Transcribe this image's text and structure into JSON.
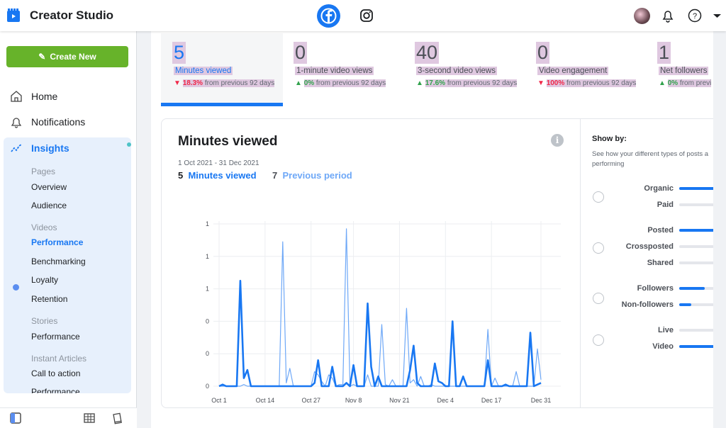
{
  "header": {
    "title": "Creator Studio",
    "icons": [
      "creator-studio-logo",
      "facebook-icon",
      "instagram-icon",
      "avatar",
      "bell-icon",
      "help-icon",
      "dropdown-caret-icon"
    ]
  },
  "sidebar": {
    "create_label": "Create New",
    "nav": [
      {
        "label": "Home",
        "icon": "home-icon"
      },
      {
        "label": "Notifications",
        "icon": "bell-icon"
      },
      {
        "label": "Insights",
        "icon": "insights-icon"
      }
    ],
    "groups": [
      {
        "label": "Pages",
        "items": [
          "Overview",
          "Audience"
        ]
      },
      {
        "label": "Videos",
        "items": [
          "Performance",
          "Benchmarking",
          "Loyalty",
          "Retention"
        ]
      },
      {
        "label": "Stories",
        "items": [
          "Performance"
        ]
      },
      {
        "label": "Instant Articles",
        "items": [
          "Call to action",
          "Performance"
        ]
      }
    ],
    "active_item": "Performance"
  },
  "metrics": [
    {
      "value": "5",
      "label": "Minutes viewed",
      "direction": "down",
      "change": "18.3%",
      "suffix": "from previous 92 days"
    },
    {
      "value": "0",
      "label": "1-minute video views",
      "direction": "up",
      "change": "0%",
      "suffix": "from previous 92 days"
    },
    {
      "value": "40",
      "label": "3-second video views",
      "direction": "up",
      "change": "17.6%",
      "suffix": "from previous 92 days"
    },
    {
      "value": "0",
      "label": "Video engagement",
      "direction": "down",
      "change": "100%",
      "suffix": "from previous 92 days"
    },
    {
      "value": "1",
      "label": "Net followers",
      "direction": "up",
      "change": "0%",
      "suffix": "from previ"
    }
  ],
  "chart_card": {
    "title": "Minutes viewed",
    "info": "i",
    "range": "1 Oct 2021 - 31 Dec 2021",
    "current_value": "5",
    "current_label": "Minutes viewed",
    "previous_value": "7",
    "previous_label": "Previous period"
  },
  "chart_data": {
    "type": "line",
    "x_start": "2021-10-01",
    "x_end": "2021-12-31",
    "x_ticks": [
      "Oct 1",
      "Oct 14",
      "Oct 27",
      "Nov 8",
      "Nov 21",
      "Dec 4",
      "Dec 17",
      "Dec 31"
    ],
    "y_ticks": [
      "0",
      "0",
      "0",
      "1",
      "1",
      "1"
    ],
    "ylim": [
      0,
      1
    ],
    "grid": true,
    "series": [
      {
        "name": "Minutes viewed",
        "color": "#1877f2",
        "values": [
          0,
          0.01,
          0,
          0,
          0,
          0,
          0.65,
          0.05,
          0.1,
          0,
          0,
          0,
          0,
          0,
          0,
          0,
          0,
          0,
          0,
          0,
          0,
          0,
          0,
          0,
          0,
          0,
          0,
          0.02,
          0.16,
          0,
          0,
          0,
          0.12,
          0,
          0,
          0,
          0.02,
          0,
          0.13,
          0,
          0,
          0,
          0.51,
          0.12,
          0,
          0.06,
          0,
          0,
          0,
          0,
          0,
          0,
          0,
          0,
          0.1,
          0.25,
          0.02,
          0,
          0,
          0,
          0,
          0.14,
          0.03,
          0.02,
          0,
          0,
          0.4,
          0,
          0,
          0.06,
          0,
          0,
          0,
          0,
          0,
          0,
          0.16,
          0,
          0,
          0,
          0,
          0.01,
          0,
          0,
          0,
          0,
          0,
          0,
          0.33,
          0,
          0.01,
          0.02
        ]
      },
      {
        "name": "Previous period",
        "color": "#6ea8f7",
        "values": [
          0,
          0,
          0,
          0,
          0,
          0,
          0,
          0.01,
          0,
          0,
          0,
          0,
          0,
          0,
          0,
          0,
          0,
          0,
          0.89,
          0.02,
          0.11,
          0,
          0,
          0,
          0,
          0,
          0,
          0.09,
          0.07,
          0.03,
          0,
          0.07,
          0.05,
          0,
          0.01,
          0.01,
          0.97,
          0,
          0.01,
          0,
          0,
          0,
          0.07,
          0,
          0,
          0,
          0.38,
          0.01,
          0,
          0.04,
          0,
          0,
          0,
          0.48,
          0.02,
          0.04,
          0,
          0.06,
          0,
          0,
          0.01,
          0,
          0,
          0,
          0,
          0,
          0,
          0,
          0,
          0,
          0,
          0,
          0,
          0,
          0,
          0,
          0.35,
          0,
          0.05,
          0,
          0,
          0,
          0,
          0,
          0.09,
          0,
          0,
          0,
          0,
          0,
          0.23,
          0.04
        ]
      }
    ]
  },
  "show_by": {
    "title": "Show by:",
    "description": "See how your different types of posts a performing",
    "groups": [
      [
        {
          "label": "Organic",
          "fill": 1
        },
        {
          "label": "Paid",
          "fill": 0
        }
      ],
      [
        {
          "label": "Posted",
          "fill": 1
        },
        {
          "label": "Crossposted",
          "fill": 0
        },
        {
          "label": "Shared",
          "fill": 0
        }
      ],
      [
        {
          "label": "Followers",
          "fill": 0.67
        },
        {
          "label": "Non-followers",
          "fill": 0.33
        }
      ],
      [
        {
          "label": "Live",
          "fill": 0
        },
        {
          "label": "Video",
          "fill": 1
        }
      ]
    ]
  },
  "colors": {
    "accent": "#1877f2",
    "create": "#67b32a",
    "up": "#31a24c",
    "down": "#f02849"
  }
}
